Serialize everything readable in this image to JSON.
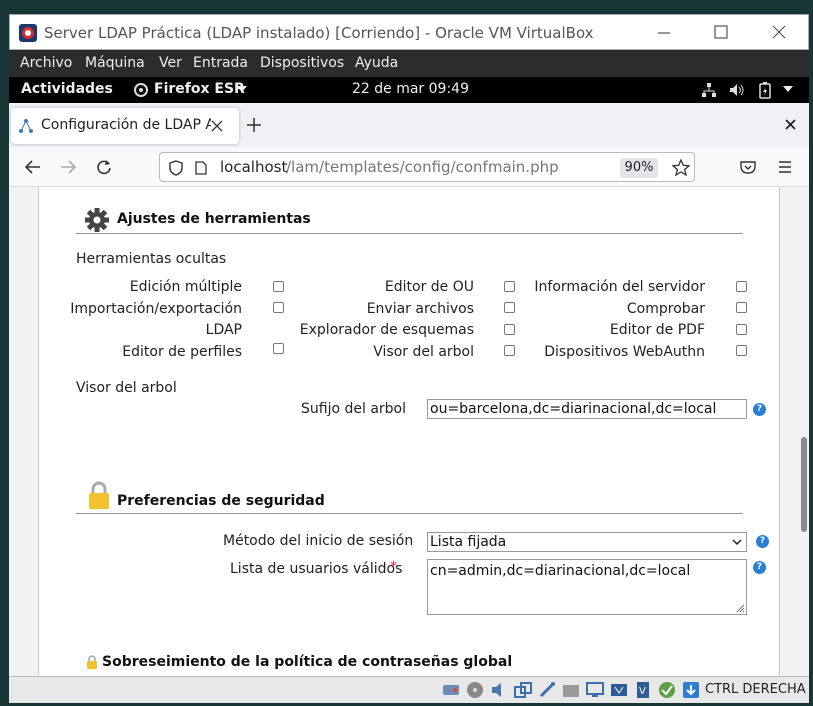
{
  "window": {
    "title": "Server LDAP Práctica (LDAP instalado) [Corriendo] - Oracle VM VirtualBox",
    "menu": [
      "Archivo",
      "Máquina",
      "Ver",
      "Entrada",
      "Dispositivos",
      "Ayuda"
    ]
  },
  "gnome_bar": {
    "activities": "Actividades",
    "app": "Firefox ESR",
    "datetime": "22 de mar  09:49"
  },
  "browser": {
    "tab_title": "Configuración de LDAP Ac",
    "url_host": "localhost",
    "url_path": "/lam/templates/config/confmain.php",
    "zoom": "90%"
  },
  "tools_section": {
    "title": "Ajustes de herramientas",
    "hidden_tools_label": "Herramientas ocultas",
    "tools": [
      [
        "Edición múltiple",
        "Editor de OU",
        "Información del servidor"
      ],
      [
        "Importación/exportación",
        "Enviar archivos",
        "Comprobar"
      ],
      [
        "LDAP",
        "Explorador de esquemas",
        "Editor de PDF"
      ],
      [
        "Editor de perfiles",
        "Visor del arbol",
        "Dispositivos WebAuthn"
      ]
    ],
    "tree_viewer_label": "Visor del arbol",
    "tree_suffix_label": "Sufijo del arbol",
    "tree_suffix_value": "ou=barcelona,dc=diarinacional,dc=local"
  },
  "security_section": {
    "title": "Preferencias de seguridad",
    "login_method_label": "Método del inicio de sesión",
    "login_method_value": "Lista fijada",
    "valid_users_label": "Lista de usuarios válidos",
    "required_mark": "*",
    "valid_users_value": "cn=admin,dc=diarinacional,dc=local"
  },
  "password_section": {
    "title": "Sobreseimiento de la política de contraseñas global"
  },
  "statusbar": {
    "host_key": "CTRL DERECHA"
  },
  "colors": {
    "help_icon": "#2a7fd4",
    "lock_icon": "#f2c230",
    "vbox_menu_bg": "#2c2c2c"
  }
}
